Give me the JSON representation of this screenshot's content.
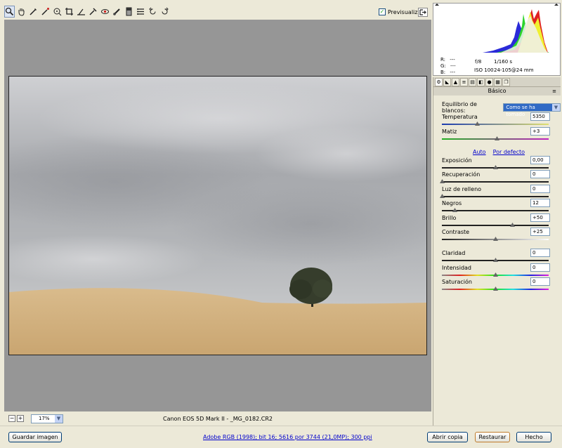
{
  "toolbar": {
    "tools": [
      "zoom-icon",
      "hand-icon",
      "white-balance-icon",
      "color-sampler-icon",
      "target-adjust-icon",
      "crop-icon",
      "straighten-icon",
      "spot-removal-icon",
      "red-eye-icon",
      "adjustment-brush-icon",
      "graduated-filter-icon",
      "preferences-icon",
      "rotate-left-icon",
      "rotate-right-icon"
    ],
    "preview_label": "Previsualizar",
    "preview_checked": true
  },
  "histogram": {
    "r_label": "R:",
    "r_value": "---",
    "g_label": "G:",
    "g_value": "---",
    "b_label": "B:",
    "b_value": "---",
    "aperture": "f/8",
    "shutter": "1/160 s",
    "iso": "ISO 100",
    "lens": "24-105@24 mm"
  },
  "panel": {
    "tabs": [
      "basic-tab-icon",
      "tone-curve-tab-icon",
      "detail-tab-icon",
      "hsl-tab-icon",
      "split-toning-tab-icon",
      "lens-tab-icon",
      "camera-calibration-tab-icon",
      "presets-tab-icon",
      "snapshots-tab-icon"
    ],
    "title": "Básico",
    "white_balance_label": "Equilibrio de blancos:",
    "white_balance_value": "Como se ha tomado",
    "auto_label": "Auto",
    "default_label": "Por defecto",
    "sliders": {
      "temperatura": {
        "label": "Temperatura",
        "value": "5350",
        "level": 0.33
      },
      "matiz": {
        "label": "Matiz",
        "value": "+3",
        "level": 0.51
      },
      "exposicion": {
        "label": "Exposición",
        "value": "0,00",
        "level": 0.5
      },
      "recuperacion": {
        "label": "Recuperación",
        "value": "0",
        "level": 0.0
      },
      "luz_relleno": {
        "label": "Luz de relleno",
        "value": "0",
        "level": 0.0
      },
      "negros": {
        "label": "Negros",
        "value": "12",
        "level": 0.12
      },
      "brillo": {
        "label": "Brillo",
        "value": "+50",
        "level": 0.66
      },
      "contraste": {
        "label": "Contraste",
        "value": "+25",
        "level": 0.5
      },
      "claridad": {
        "label": "Claridad",
        "value": "0",
        "level": 0.5
      },
      "intensidad": {
        "label": "Intensidad",
        "value": "0",
        "level": 0.5
      },
      "saturacion": {
        "label": "Saturación",
        "value": "0",
        "level": 0.5
      }
    }
  },
  "status": {
    "zoom_minus": "−",
    "zoom_plus": "+",
    "zoom_value": "17%",
    "filename": "Canon EOS 5D Mark II - _MG_0182.CR2"
  },
  "footer": {
    "save_label": "Guardar imagen",
    "file_info": "Adobe RGB (1998); bit 16; 5616 por 3744 (21,0MP); 300 ppi",
    "open_copy_label": "Abrir copia",
    "reset_label": "Restaurar",
    "done_label": "Hecho"
  }
}
